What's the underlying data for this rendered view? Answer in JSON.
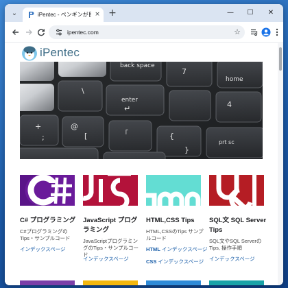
{
  "browser": {
    "tab": {
      "title": "iPentec - ペンギンが目印の技術情報サイト",
      "close_glyph": "×"
    },
    "new_tab_glyph": "+",
    "window_controls": {
      "minimize": "—",
      "maximize": "☐",
      "close": "✕"
    },
    "toolbar": {
      "back_icon": "arrow-left-icon",
      "forward_icon": "arrow-right-icon",
      "reload_icon": "reload-icon",
      "url": "ipentec.com",
      "bookmark_icon": "star-icon"
    }
  },
  "site": {
    "logo_text": "iPentec",
    "hero": {
      "keys": [
        "back space",
        "enter",
        "home",
        "7",
        "4",
        "\\",
        "@",
        "[",
        "「",
        "{",
        "}",
        "+",
        ";",
        "↵",
        "prt sc"
      ]
    },
    "cards": [
      {
        "title": "C# プログラミング",
        "desc": "C#プログラミングのTips・サンプルコード",
        "links": [
          {
            "prefix": "",
            "text": "インデックスページ"
          }
        ],
        "colors": {
          "bg": "#ffffff",
          "accent": "#6a1b9a"
        }
      },
      {
        "title": "JavaScript プログラミング",
        "desc": "JavaScriptプログラミングのTips・サンプルコード",
        "links": [
          {
            "prefix": "",
            "text": "インデックスページ"
          }
        ],
        "colors": {
          "bg": "#b3123a",
          "accent": "#ffffff"
        }
      },
      {
        "title": "HTML,CSS Tips",
        "desc": "HTML,CSSのTips サンプルコード",
        "links": [
          {
            "prefix": "HTML",
            "text": "インデックスページ"
          },
          {
            "prefix": "CSS",
            "text": "インデックスページ"
          }
        ],
        "colors": {
          "bg": "#63ddd3",
          "accent": "#ffffff"
        }
      },
      {
        "title": "SQL文 SQL Server Tips",
        "desc": "SQL文やSQL ServerのTips, 操作手順",
        "links": [
          {
            "prefix": "",
            "text": "インデックスページ"
          }
        ],
        "colors": {
          "bg": "#b51d24",
          "accent": "#ffffff"
        }
      }
    ],
    "bottom_strip_colors": [
      "#7b3fa8",
      "#f2b70f",
      "#2e8bd8",
      "#19a3a8"
    ]
  }
}
